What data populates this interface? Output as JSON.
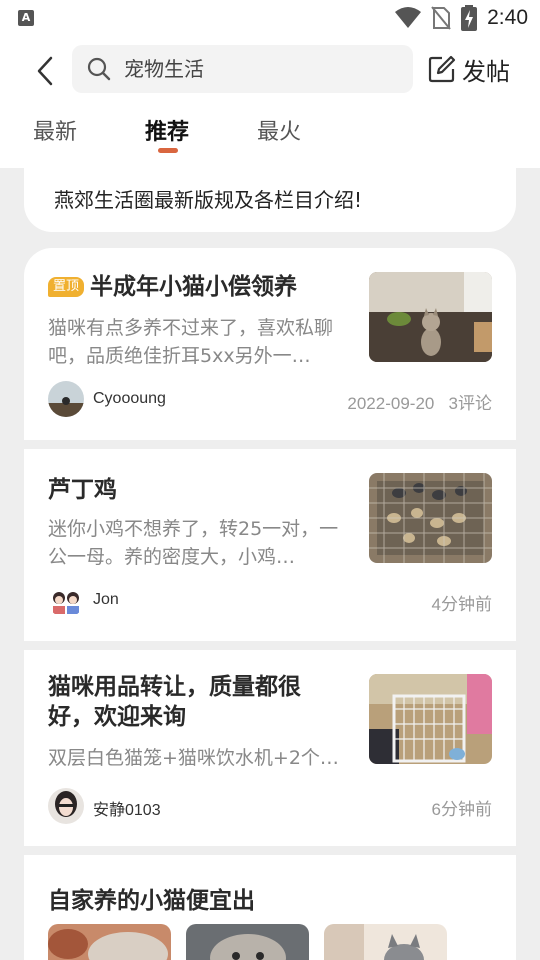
{
  "status_bar": {
    "app_icon": "A",
    "time": "2:40"
  },
  "header": {
    "search": {
      "text": "宠物生活"
    },
    "post_button_label": "发帖",
    "tabs": [
      {
        "label": "最新",
        "active": false
      },
      {
        "label": "推荐",
        "active": true
      },
      {
        "label": "最火",
        "active": false
      }
    ]
  },
  "notice": {
    "text": "燕郊生活圈最新版规及各栏目介绍!"
  },
  "posts": [
    {
      "pinned_badge": "置顶",
      "title": "半成年小猫小偿领养",
      "desc": "猫咪有点多养不过来了，喜欢私聊吧，品质绝佳折耳5xx另外一…",
      "author": "Cyoooung",
      "date": "2022-09-20",
      "comments": "3评论"
    },
    {
      "title": "芦丁鸡",
      "desc": "迷你小鸡不想养了，转25一对，一公一母。养的密度大，小鸡…",
      "author": "Jon",
      "time": "4分钟前"
    },
    {
      "title": "猫咪用品转让，质量都很好，欢迎来询",
      "desc": "双层白色猫笼+猫咪饮水机+2个…",
      "author": "安静0103",
      "time": "6分钟前"
    }
  ],
  "bottom_post": {
    "title": "自家养的小猫便宜出"
  },
  "colors": {
    "accent": "#d9663f",
    "pin_badge": "#f0b030",
    "background": "#eeeeee"
  }
}
